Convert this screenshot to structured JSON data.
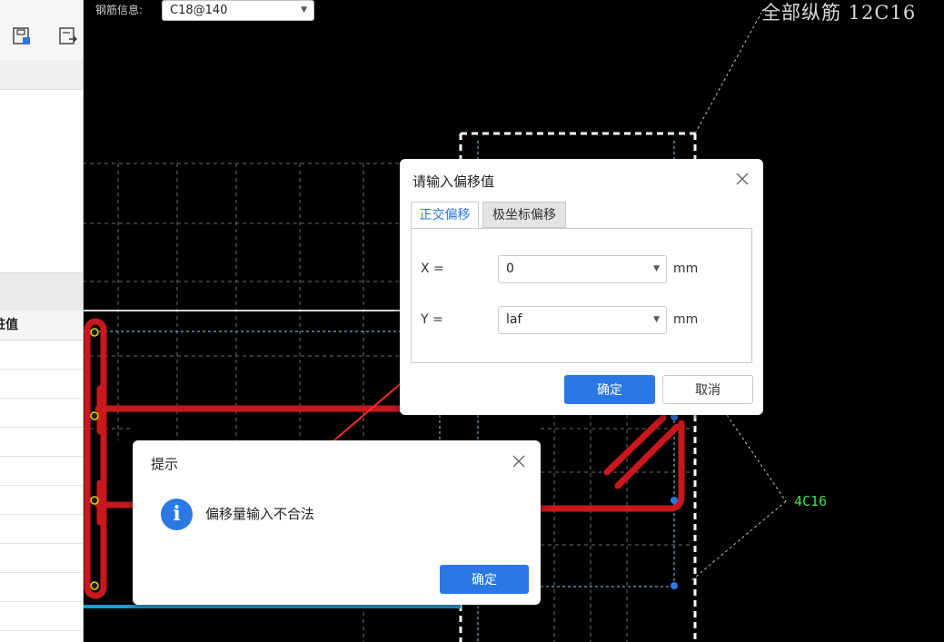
{
  "toolbar": {
    "rebar_label": "钢筋信息:",
    "rebar_value": "C18@140"
  },
  "left_panel": {
    "column_header": "桩值"
  },
  "canvas": {
    "total_rebar_text": "全部纵筋  12C16",
    "side_rebar_text": "4C16"
  },
  "offset_dialog": {
    "title": "请输入偏移值",
    "tabs": [
      {
        "label": "正交偏移",
        "active": true
      },
      {
        "label": "极坐标偏移",
        "active": false
      }
    ],
    "x_label": "X =",
    "x_value": "0",
    "y_label": "Y =",
    "y_value": "laf",
    "unit": "mm",
    "ok_label": "确定",
    "cancel_label": "取消"
  },
  "tip_dialog": {
    "title": "提示",
    "message": "偏移量输入不合法",
    "ok_label": "确定"
  },
  "colors": {
    "rebar_red": "#c8181e",
    "accent_blue": "#2b78e4",
    "grid": "#6e6e6e",
    "label_green": "#3fe05a"
  }
}
